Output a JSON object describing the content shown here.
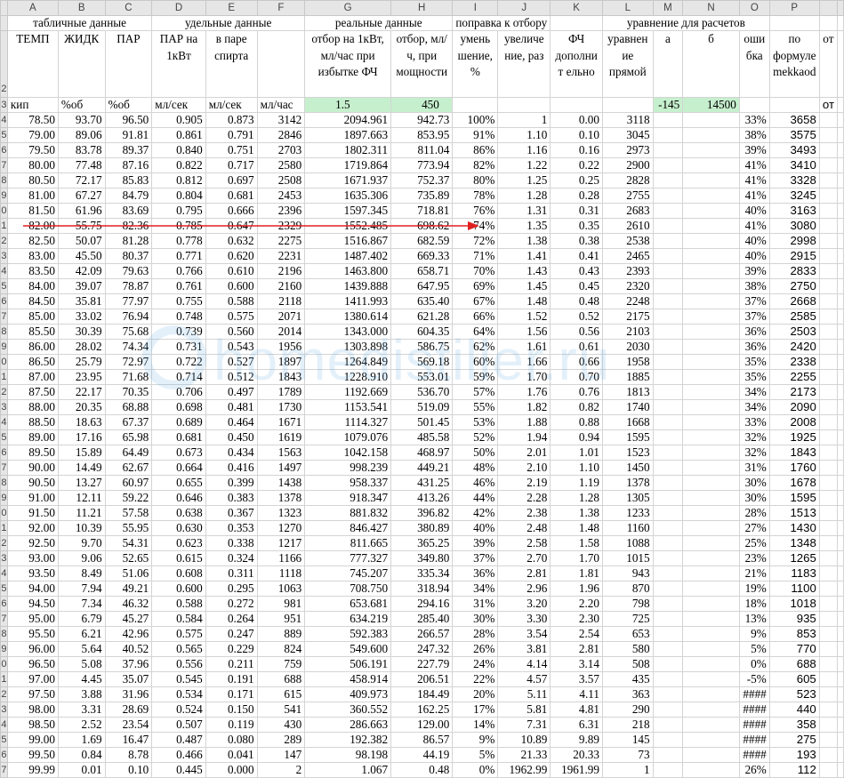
{
  "column_letters": [
    "A",
    "B",
    "C",
    "D",
    "E",
    "F",
    "G",
    "H",
    "I",
    "J",
    "K",
    "L",
    "M",
    "N",
    "O",
    "P"
  ],
  "group_headers": {
    "tabular": "табличные данные",
    "specific": "удельные данные",
    "real": "реальные данные",
    "correction": "поправка к отбору",
    "equation": "уравнение для расчетов"
  },
  "headers": {
    "A": "ТЕМП",
    "B": "ЖИДК",
    "C": "ПАР",
    "D": "ПАР на 1кВт",
    "E": "в паре спирта",
    "G": "отбор на 1кВт, мл/час при избытке ФЧ",
    "H": "отбор, мл/ч, при мощности",
    "I": "умень шение, %",
    "J": "увеличе ние, раз",
    "K": "ФЧ дополнит ельно",
    "L": "уравнен ие прямой",
    "M": "а",
    "N": "б",
    "O": "оши бка",
    "P": "по формуле mekkaod",
    "Q": "от"
  },
  "units": {
    "A": "кип",
    "B": "%об",
    "C": "%об",
    "D": "мл/сек",
    "E": "мл/сек",
    "F": "мл/час",
    "G": "1.5",
    "H": "450",
    "M": "-145",
    "N": "14500",
    "Q": "от"
  },
  "colors": {
    "green": "#c6efce",
    "arrow": "#e02020",
    "header_bg": "#e6e6e6",
    "grid": "#d4d4d4",
    "watermark": "#6ab0e6"
  },
  "watermark_text": "homedistiller.ru",
  "rows": [
    [
      "78.50",
      "93.70",
      "96.50",
      "0.905",
      "0.873",
      "3142",
      "2094.961",
      "942.73",
      "100%",
      "1",
      "0.00",
      "3118",
      "",
      "",
      "33%",
      "3658"
    ],
    [
      "79.00",
      "89.06",
      "91.81",
      "0.861",
      "0.791",
      "2846",
      "1897.663",
      "853.95",
      "91%",
      "1.10",
      "0.10",
      "3045",
      "",
      "",
      "38%",
      "3575"
    ],
    [
      "79.50",
      "83.78",
      "89.37",
      "0.840",
      "0.751",
      "2703",
      "1802.311",
      "811.04",
      "86%",
      "1.16",
      "0.16",
      "2973",
      "",
      "",
      "39%",
      "3493"
    ],
    [
      "80.00",
      "77.48",
      "87.16",
      "0.822",
      "0.717",
      "2580",
      "1719.864",
      "773.94",
      "82%",
      "1.22",
      "0.22",
      "2900",
      "",
      "",
      "41%",
      "3410"
    ],
    [
      "80.50",
      "72.17",
      "85.83",
      "0.812",
      "0.697",
      "2508",
      "1671.937",
      "752.37",
      "80%",
      "1.25",
      "0.25",
      "2828",
      "",
      "",
      "41%",
      "3328"
    ],
    [
      "81.00",
      "67.27",
      "84.79",
      "0.804",
      "0.681",
      "2453",
      "1635.306",
      "735.89",
      "78%",
      "1.28",
      "0.28",
      "2755",
      "",
      "",
      "41%",
      "3245"
    ],
    [
      "81.50",
      "61.96",
      "83.69",
      "0.795",
      "0.666",
      "2396",
      "1597.345",
      "718.81",
      "76%",
      "1.31",
      "0.31",
      "2683",
      "",
      "",
      "40%",
      "3163"
    ],
    [
      "82.00",
      "55.75",
      "82.36",
      "0.785",
      "0.647",
      "2329",
      "1552.485",
      "698.62",
      "74%",
      "1.35",
      "0.35",
      "2610",
      "",
      "",
      "41%",
      "3080"
    ],
    [
      "82.50",
      "50.07",
      "81.28",
      "0.778",
      "0.632",
      "2275",
      "1516.867",
      "682.59",
      "72%",
      "1.38",
      "0.38",
      "2538",
      "",
      "",
      "40%",
      "2998"
    ],
    [
      "83.00",
      "45.50",
      "80.37",
      "0.771",
      "0.620",
      "2231",
      "1487.402",
      "669.33",
      "71%",
      "1.41",
      "0.41",
      "2465",
      "",
      "",
      "40%",
      "2915"
    ],
    [
      "83.50",
      "42.09",
      "79.63",
      "0.766",
      "0.610",
      "2196",
      "1463.800",
      "658.71",
      "70%",
      "1.43",
      "0.43",
      "2393",
      "",
      "",
      "39%",
      "2833"
    ],
    [
      "84.00",
      "39.07",
      "78.87",
      "0.761",
      "0.600",
      "2160",
      "1439.888",
      "647.95",
      "69%",
      "1.45",
      "0.45",
      "2320",
      "",
      "",
      "38%",
      "2750"
    ],
    [
      "84.50",
      "35.81",
      "77.97",
      "0.755",
      "0.588",
      "2118",
      "1411.993",
      "635.40",
      "67%",
      "1.48",
      "0.48",
      "2248",
      "",
      "",
      "37%",
      "2668"
    ],
    [
      "85.00",
      "33.02",
      "76.94",
      "0.748",
      "0.575",
      "2071",
      "1380.614",
      "621.28",
      "66%",
      "1.52",
      "0.52",
      "2175",
      "",
      "",
      "37%",
      "2585"
    ],
    [
      "85.50",
      "30.39",
      "75.68",
      "0.739",
      "0.560",
      "2014",
      "1343.000",
      "604.35",
      "64%",
      "1.56",
      "0.56",
      "2103",
      "",
      "",
      "36%",
      "2503"
    ],
    [
      "86.00",
      "28.02",
      "74.34",
      "0.731",
      "0.543",
      "1956",
      "1303.898",
      "586.75",
      "62%",
      "1.61",
      "0.61",
      "2030",
      "",
      "",
      "36%",
      "2420"
    ],
    [
      "86.50",
      "25.79",
      "72.97",
      "0.722",
      "0.527",
      "1897",
      "1264.849",
      "569.18",
      "60%",
      "1.66",
      "0.66",
      "1958",
      "",
      "",
      "35%",
      "2338"
    ],
    [
      "87.00",
      "23.95",
      "71.68",
      "0.714",
      "0.512",
      "1843",
      "1228.910",
      "553.01",
      "59%",
      "1.70",
      "0.70",
      "1885",
      "",
      "",
      "35%",
      "2255"
    ],
    [
      "87.50",
      "22.17",
      "70.35",
      "0.706",
      "0.497",
      "1789",
      "1192.669",
      "536.70",
      "57%",
      "1.76",
      "0.76",
      "1813",
      "",
      "",
      "34%",
      "2173"
    ],
    [
      "88.00",
      "20.35",
      "68.88",
      "0.698",
      "0.481",
      "1730",
      "1153.541",
      "519.09",
      "55%",
      "1.82",
      "0.82",
      "1740",
      "",
      "",
      "34%",
      "2090"
    ],
    [
      "88.50",
      "18.63",
      "67.37",
      "0.689",
      "0.464",
      "1671",
      "1114.327",
      "501.45",
      "53%",
      "1.88",
      "0.88",
      "1668",
      "",
      "",
      "33%",
      "2008"
    ],
    [
      "89.00",
      "17.16",
      "65.98",
      "0.681",
      "0.450",
      "1619",
      "1079.076",
      "485.58",
      "52%",
      "1.94",
      "0.94",
      "1595",
      "",
      "",
      "32%",
      "1925"
    ],
    [
      "89.50",
      "15.89",
      "64.49",
      "0.673",
      "0.434",
      "1563",
      "1042.158",
      "468.97",
      "50%",
      "2.01",
      "1.01",
      "1523",
      "",
      "",
      "32%",
      "1843"
    ],
    [
      "90.00",
      "14.49",
      "62.67",
      "0.664",
      "0.416",
      "1497",
      "998.239",
      "449.21",
      "48%",
      "2.10",
      "1.10",
      "1450",
      "",
      "",
      "31%",
      "1760"
    ],
    [
      "90.50",
      "13.27",
      "60.97",
      "0.655",
      "0.399",
      "1438",
      "958.337",
      "431.25",
      "46%",
      "2.19",
      "1.19",
      "1378",
      "",
      "",
      "30%",
      "1678"
    ],
    [
      "91.00",
      "12.11",
      "59.22",
      "0.646",
      "0.383",
      "1378",
      "918.347",
      "413.26",
      "44%",
      "2.28",
      "1.28",
      "1305",
      "",
      "",
      "30%",
      "1595"
    ],
    [
      "91.50",
      "11.21",
      "57.58",
      "0.638",
      "0.367",
      "1323",
      "881.832",
      "396.82",
      "42%",
      "2.38",
      "1.38",
      "1233",
      "",
      "",
      "28%",
      "1513"
    ],
    [
      "92.00",
      "10.39",
      "55.95",
      "0.630",
      "0.353",
      "1270",
      "846.427",
      "380.89",
      "40%",
      "2.48",
      "1.48",
      "1160",
      "",
      "",
      "27%",
      "1430"
    ],
    [
      "92.50",
      "9.70",
      "54.31",
      "0.623",
      "0.338",
      "1217",
      "811.665",
      "365.25",
      "39%",
      "2.58",
      "1.58",
      "1088",
      "",
      "",
      "25%",
      "1348"
    ],
    [
      "93.00",
      "9.06",
      "52.65",
      "0.615",
      "0.324",
      "1166",
      "777.327",
      "349.80",
      "37%",
      "2.70",
      "1.70",
      "1015",
      "",
      "",
      "23%",
      "1265"
    ],
    [
      "93.50",
      "8.49",
      "51.06",
      "0.608",
      "0.311",
      "1118",
      "745.207",
      "335.34",
      "36%",
      "2.81",
      "1.81",
      "943",
      "",
      "",
      "21%",
      "1183"
    ],
    [
      "94.00",
      "7.94",
      "49.21",
      "0.600",
      "0.295",
      "1063",
      "708.750",
      "318.94",
      "34%",
      "2.96",
      "1.96",
      "870",
      "",
      "",
      "19%",
      "1100"
    ],
    [
      "94.50",
      "7.34",
      "46.32",
      "0.588",
      "0.272",
      "981",
      "653.681",
      "294.16",
      "31%",
      "3.20",
      "2.20",
      "798",
      "",
      "",
      "18%",
      "1018"
    ],
    [
      "95.00",
      "6.79",
      "45.27",
      "0.584",
      "0.264",
      "951",
      "634.219",
      "285.40",
      "30%",
      "3.30",
      "2.30",
      "725",
      "",
      "",
      "13%",
      "935"
    ],
    [
      "95.50",
      "6.21",
      "42.96",
      "0.575",
      "0.247",
      "889",
      "592.383",
      "266.57",
      "28%",
      "3.54",
      "2.54",
      "653",
      "",
      "",
      "9%",
      "853"
    ],
    [
      "96.00",
      "5.64",
      "40.52",
      "0.565",
      "0.229",
      "824",
      "549.600",
      "247.32",
      "26%",
      "3.81",
      "2.81",
      "580",
      "",
      "",
      "5%",
      "770"
    ],
    [
      "96.50",
      "5.08",
      "37.96",
      "0.556",
      "0.211",
      "759",
      "506.191",
      "227.79",
      "24%",
      "4.14",
      "3.14",
      "508",
      "",
      "",
      "0%",
      "688"
    ],
    [
      "97.00",
      "4.45",
      "35.07",
      "0.545",
      "0.191",
      "688",
      "458.914",
      "206.51",
      "22%",
      "4.57",
      "3.57",
      "435",
      "",
      "",
      "-5%",
      "605"
    ],
    [
      "97.50",
      "3.88",
      "31.96",
      "0.534",
      "0.171",
      "615",
      "409.973",
      "184.49",
      "20%",
      "5.11",
      "4.11",
      "363",
      "",
      "",
      "####",
      "523"
    ],
    [
      "98.00",
      "3.31",
      "28.69",
      "0.524",
      "0.150",
      "541",
      "360.552",
      "162.25",
      "17%",
      "5.81",
      "4.81",
      "290",
      "",
      "",
      "####",
      "440"
    ],
    [
      "98.50",
      "2.52",
      "23.54",
      "0.507",
      "0.119",
      "430",
      "286.663",
      "129.00",
      "14%",
      "7.31",
      "6.31",
      "218",
      "",
      "",
      "####",
      "358"
    ],
    [
      "99.00",
      "1.69",
      "16.47",
      "0.487",
      "0.080",
      "289",
      "192.382",
      "86.57",
      "9%",
      "10.89",
      "9.89",
      "145",
      "",
      "",
      "####",
      "275"
    ],
    [
      "99.50",
      "0.84",
      "8.78",
      "0.466",
      "0.041",
      "147",
      "98.198",
      "44.19",
      "5%",
      "21.33",
      "20.33",
      "73",
      "",
      "",
      "####",
      "193"
    ],
    [
      "99.99",
      "0.01",
      "0.10",
      "0.445",
      "0.000",
      "2",
      "1.067",
      "0.48",
      "0%",
      "1962.99",
      "1961.99",
      "1",
      "",
      "",
      "26%",
      "112"
    ]
  ]
}
